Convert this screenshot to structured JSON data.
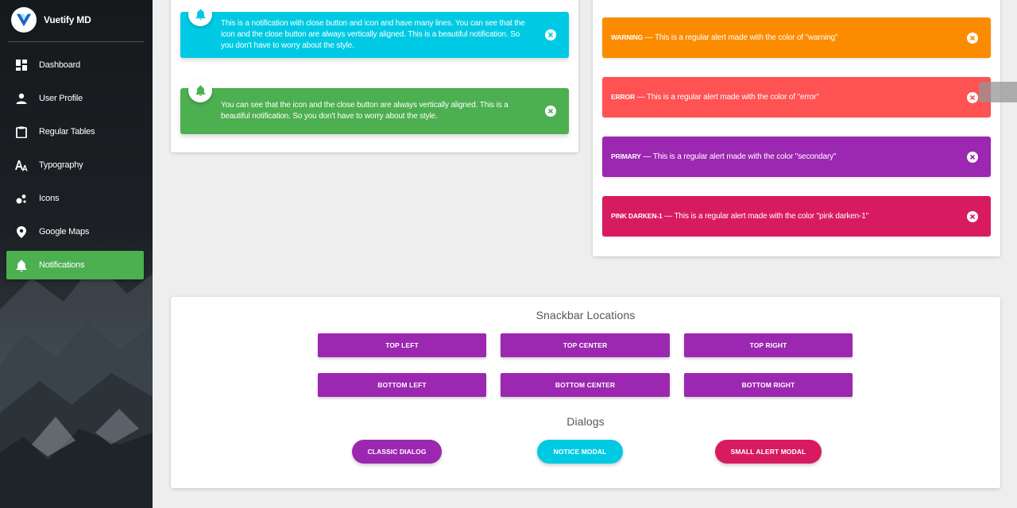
{
  "sidebar": {
    "brand": "Vuetify MD",
    "items": [
      {
        "label": "Dashboard",
        "icon": "dashboard-icon"
      },
      {
        "label": "User Profile",
        "icon": "person-icon"
      },
      {
        "label": "Regular Tables",
        "icon": "clipboard-icon"
      },
      {
        "label": "Typography",
        "icon": "typography-icon"
      },
      {
        "label": "Icons",
        "icon": "bubble-chart-icon"
      },
      {
        "label": "Google Maps",
        "icon": "map-marker-icon"
      },
      {
        "label": "Notifications",
        "icon": "bell-icon",
        "active": true
      }
    ]
  },
  "notifications": [
    {
      "text": "This is a notification with close button and icon and have many lines. You can see that the icon and the close button are always vertically aligned. This is a beautiful notification. So you don't have to worry about the style.",
      "color": "#00cae3"
    },
    {
      "text": "You can see that the icon and the close button are always vertically aligned. This is a beautiful notification. So you don't have to worry about the style.",
      "color": "#4caf50"
    }
  ],
  "alerts": [
    {
      "strong": "WARNING",
      "text": " — This is a regular alert made with the color of \"warning\"",
      "color": "#fb8c00"
    },
    {
      "strong": "ERROR",
      "text": " — This is a regular alert made with the color of \"error\"",
      "color": "#ff5252"
    },
    {
      "strong": "PRIMARY",
      "text": " — This is a regular alert made with the color \"secondary\"",
      "color": "#9c27b0"
    },
    {
      "strong": "PINK DARKEN-1",
      "text": " — This is a regular alert made with the color \"pink darken-1\"",
      "color": "#d81b60"
    }
  ],
  "snackbar": {
    "title": "Snackbar Locations",
    "buttons": [
      "TOP LEFT",
      "TOP CENTER",
      "TOP RIGHT",
      "BOTTOM LEFT",
      "BOTTOM CENTER",
      "BOTTOM RIGHT"
    ]
  },
  "dialogs": {
    "title": "Dialogs",
    "buttons": [
      {
        "label": "CLASSIC DIALOG",
        "color": "#9c27b0"
      },
      {
        "label": "NOTICE MODAL",
        "color": "#00cae3"
      },
      {
        "label": "SMALL ALERT MODAL",
        "color": "#d81b60"
      }
    ]
  }
}
